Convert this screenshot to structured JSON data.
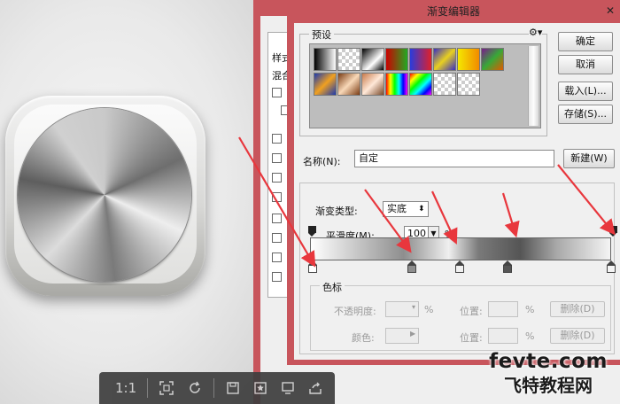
{
  "toolbar": {
    "ratio_label": "1:1"
  },
  "layer_style": {
    "items": [
      "样式",
      "混合"
    ]
  },
  "gradient_editor": {
    "title": "渐变编辑器",
    "presets_label": "预设",
    "buttons": {
      "ok": "确定",
      "cancel": "取消",
      "load": "载入(L)...",
      "save": "存储(S)...",
      "new": "新建(W)"
    },
    "name_label": "名称(N):",
    "name_value": "自定",
    "gradient_type_label": "渐变类型:",
    "gradient_type_value": "实底",
    "smoothness_label": "平滑度(M):",
    "smoothness_value": "100",
    "smoothness_unit": "%",
    "color_stops": {
      "section_label": "色标",
      "opacity_label": "不透明度:",
      "opacity_unit": "%",
      "position_label": "位置:",
      "position_unit": "%",
      "delete_label": "删除(D)",
      "color_label": "颜色:"
    }
  },
  "watermark": {
    "site": "fevte.com",
    "name": "飞特教程网"
  },
  "colors": {
    "window_frame": "#c8555c",
    "annotation_arrow": "#e8373d"
  }
}
